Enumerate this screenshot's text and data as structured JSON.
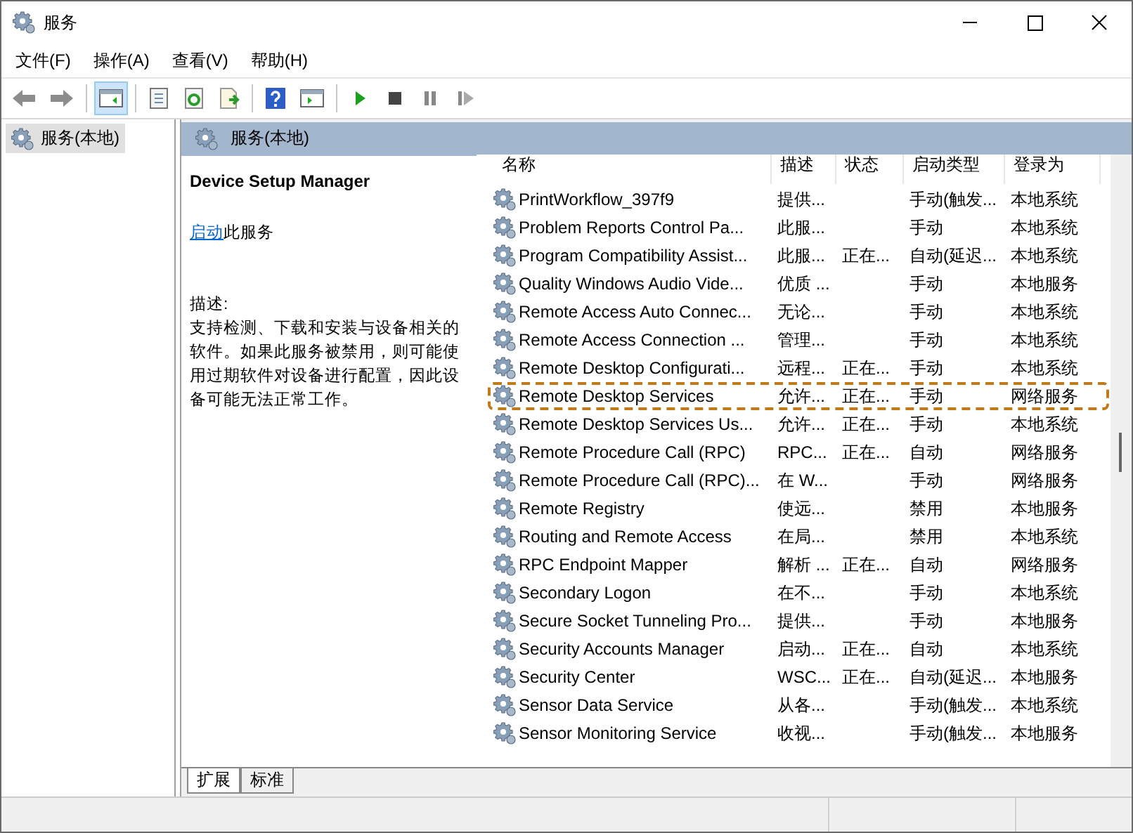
{
  "window": {
    "title": "服务"
  },
  "menu": [
    "文件(F)",
    "操作(A)",
    "查看(V)",
    "帮助(H)"
  ],
  "toolbar": [
    {
      "kind": "back",
      "selected": false
    },
    {
      "kind": "forward",
      "selected": false
    },
    {
      "kind": "tree",
      "selected": true
    },
    {
      "kind": "properties",
      "selected": false
    },
    {
      "kind": "refresh",
      "selected": false
    },
    {
      "kind": "export",
      "selected": false
    },
    {
      "kind": "help",
      "selected": false
    },
    {
      "kind": "console",
      "selected": false
    },
    {
      "kind": "play",
      "selected": false
    },
    {
      "kind": "stop",
      "selected": false
    },
    {
      "kind": "pause",
      "selected": false
    },
    {
      "kind": "resume",
      "selected": false
    }
  ],
  "tree": [
    {
      "label": "服务(本地)",
      "selected": true
    }
  ],
  "panel": {
    "title": "服务(本地)",
    "service_name": "Device Setup Manager",
    "action_link": "启动",
    "action_rest": "此服务",
    "description_label": "描述:",
    "description": "支持检测、下载和安装与设备相关的软件。如果此服务被禁用，则可能使用过期软件对设备进行配置，因此设备可能无法正常工作。"
  },
  "table": {
    "columns": [
      "名称",
      "描述",
      "状态",
      "启动类型",
      "登录为"
    ],
    "rows": [
      {
        "name": "PrintWorkflow_397f9",
        "description": "提供...",
        "status": "",
        "startup": "手动(触发...",
        "logon": "本地系统",
        "highlighted": false
      },
      {
        "name": "Problem Reports Control Pa...",
        "description": "此服...",
        "status": "",
        "startup": "手动",
        "logon": "本地系统",
        "highlighted": false
      },
      {
        "name": "Program Compatibility Assist...",
        "description": "此服...",
        "status": "正在...",
        "startup": "自动(延迟...",
        "logon": "本地系统",
        "highlighted": false
      },
      {
        "name": "Quality Windows Audio Vide...",
        "description": "优质 ...",
        "status": "",
        "startup": "手动",
        "logon": "本地服务",
        "highlighted": false
      },
      {
        "name": "Remote Access Auto Connec...",
        "description": "无论...",
        "status": "",
        "startup": "手动",
        "logon": "本地系统",
        "highlighted": false
      },
      {
        "name": "Remote Access Connection ...",
        "description": "管理...",
        "status": "",
        "startup": "手动",
        "logon": "本地系统",
        "highlighted": false
      },
      {
        "name": "Remote Desktop Configurati...",
        "description": "远程...",
        "status": "正在...",
        "startup": "手动",
        "logon": "本地系统",
        "highlighted": false
      },
      {
        "name": "Remote Desktop Services",
        "description": "允许...",
        "status": "正在...",
        "startup": "手动",
        "logon": "网络服务",
        "highlighted": true
      },
      {
        "name": "Remote Desktop Services Us...",
        "description": "允许...",
        "status": "正在...",
        "startup": "手动",
        "logon": "本地系统",
        "highlighted": false
      },
      {
        "name": "Remote Procedure Call (RPC)",
        "description": "RPC...",
        "status": "正在...",
        "startup": "自动",
        "logon": "网络服务",
        "highlighted": false
      },
      {
        "name": "Remote Procedure Call (RPC)...",
        "description": "在 W...",
        "status": "",
        "startup": "手动",
        "logon": "网络服务",
        "highlighted": false
      },
      {
        "name": "Remote Registry",
        "description": "使远...",
        "status": "",
        "startup": "禁用",
        "logon": "本地服务",
        "highlighted": false
      },
      {
        "name": "Routing and Remote Access",
        "description": "在局...",
        "status": "",
        "startup": "禁用",
        "logon": "本地系统",
        "highlighted": false
      },
      {
        "name": "RPC Endpoint Mapper",
        "description": "解析 ...",
        "status": "正在...",
        "startup": "自动",
        "logon": "网络服务",
        "highlighted": false
      },
      {
        "name": "Secondary Logon",
        "description": "在不...",
        "status": "",
        "startup": "手动",
        "logon": "本地系统",
        "highlighted": false
      },
      {
        "name": "Secure Socket Tunneling Pro...",
        "description": "提供...",
        "status": "",
        "startup": "手动",
        "logon": "本地服务",
        "highlighted": false
      },
      {
        "name": "Security Accounts Manager",
        "description": "启动...",
        "status": "正在...",
        "startup": "自动",
        "logon": "本地系统",
        "highlighted": false
      },
      {
        "name": "Security Center",
        "description": "WSC...",
        "status": "正在...",
        "startup": "自动(延迟...",
        "logon": "本地服务",
        "highlighted": false
      },
      {
        "name": "Sensor Data Service",
        "description": "从各...",
        "status": "",
        "startup": "手动(触发...",
        "logon": "本地系统",
        "highlighted": false
      },
      {
        "name": "Sensor Monitoring Service",
        "description": "收视...",
        "status": "",
        "startup": "手动(触发...",
        "logon": "本地服务",
        "highlighted": false
      }
    ]
  },
  "bottom_tabs": [
    {
      "label": "扩展",
      "selected": true
    },
    {
      "label": "标准",
      "selected": false
    }
  ]
}
